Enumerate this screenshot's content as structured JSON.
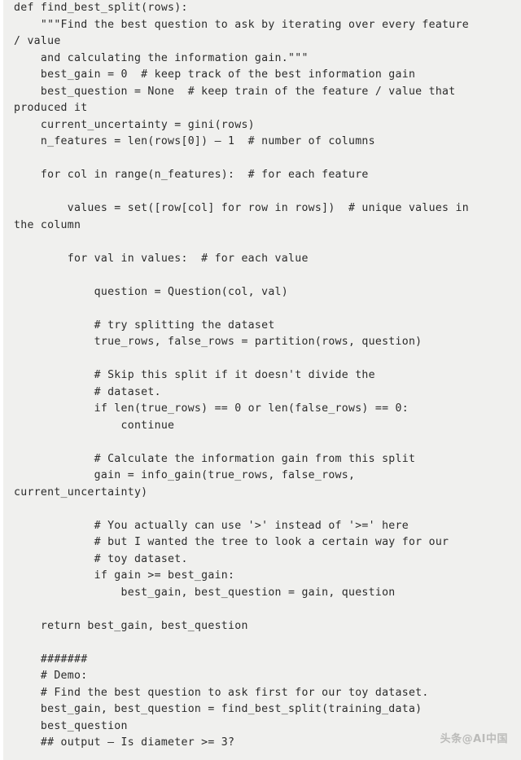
{
  "surface": {
    "background_color": "#f0f0ee",
    "text_color": "#2b2b2b",
    "left_gutter_color": "#ffffff",
    "language": "python"
  },
  "code": {
    "title": "find_best_split",
    "lines": [
      "def find_best_split(rows):",
      "    \"\"\"Find the best question to ask by iterating over every feature",
      "/ value",
      "    and calculating the information gain.\"\"\"",
      "    best_gain = 0  # keep track of the best information gain",
      "    best_question = None  # keep train of the feature / value that",
      "produced it",
      "    current_uncertainty = gini(rows)",
      "    n_features = len(rows[0]) – 1  # number of columns",
      "",
      "    for col in range(n_features):  # for each feature",
      "",
      "        values = set([row[col] for row in rows])  # unique values in",
      "the column",
      "",
      "        for val in values:  # for each value",
      "",
      "            question = Question(col, val)",
      "",
      "            # try splitting the dataset",
      "            true_rows, false_rows = partition(rows, question)",
      "",
      "            # Skip this split if it doesn't divide the",
      "            # dataset.",
      "            if len(true_rows) == 0 or len(false_rows) == 0:",
      "                continue",
      "",
      "            # Calculate the information gain from this split",
      "            gain = info_gain(true_rows, false_rows,",
      "current_uncertainty)",
      "",
      "            # You actually can use '>' instead of '>=' here",
      "            # but I wanted the tree to look a certain way for our",
      "            # toy dataset.",
      "            if gain >= best_gain:",
      "                best_gain, best_question = gain, question",
      "",
      "    return best_gain, best_question",
      "",
      "    #######",
      "    # Demo:",
      "    # Find the best question to ask first for our toy dataset.",
      "    best_gain, best_question = find_best_split(training_data)",
      "    best_question",
      "    ## output – Is diameter >= 3?"
    ]
  },
  "watermark": {
    "text": "头条@AI中国",
    "color": "#b9b9b7"
  }
}
